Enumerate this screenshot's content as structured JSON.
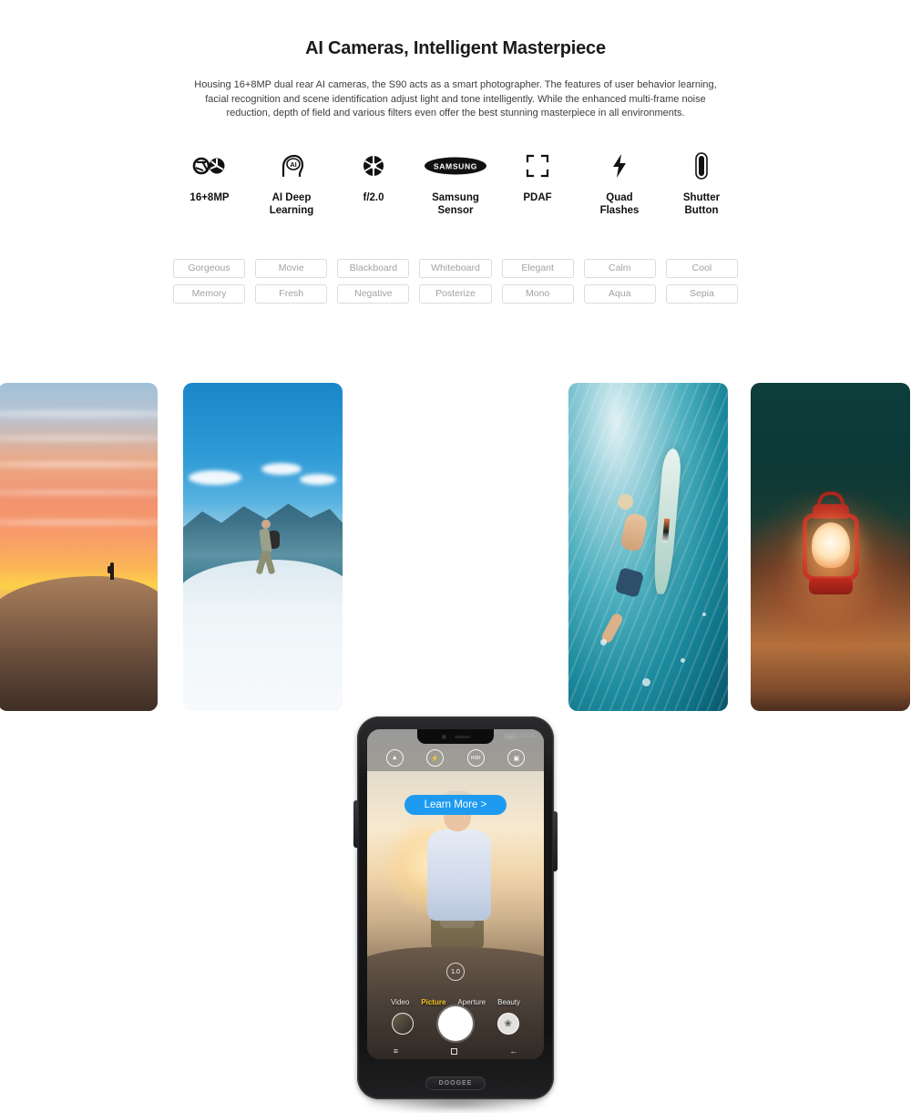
{
  "hero": {
    "title": "AI Cameras, Intelligent Masterpiece",
    "description": "Housing 16+8MP dual rear AI cameras, the S90 acts as a smart photographer. The features of user behavior learning, facial recognition and scene identification adjust light and tone intelligently. While the enhanced multi-frame noise reduction, depth of field and various filters even offer the best stunning masterpiece in all environments."
  },
  "specs": [
    {
      "icon": "dual-aperture-icon",
      "label": "16+8MP"
    },
    {
      "icon": "ai-head-icon",
      "label": "AI Deep\nLearning"
    },
    {
      "icon": "aperture-icon",
      "label": "f/2.0"
    },
    {
      "icon": "samsung-logo-icon",
      "label": "Samsung\nSensor"
    },
    {
      "icon": "focus-bracket-icon",
      "label": "PDAF"
    },
    {
      "icon": "lightning-bolt-icon",
      "label": "Quad\nFlashes"
    },
    {
      "icon": "shutter-button-icon",
      "label": "Shutter\nButton"
    }
  ],
  "filters": [
    "Gorgeous",
    "Movie",
    "Blackboard",
    "Whiteboard",
    "Elegant",
    "Calm",
    "Cool",
    "Memory",
    "Fresh",
    "Negative",
    "Posterize",
    "Mono",
    "Aqua",
    "Sepia"
  ],
  "gallery": [
    {
      "name": "desert-sunset-photo",
      "caption": "Desert sunset with lone traveler"
    },
    {
      "name": "mountain-hiker-photo",
      "caption": "Hiker on snowy mountain ridge"
    },
    {
      "name": "underwater-surfer-photo",
      "caption": "Surfer diving underwater with board"
    },
    {
      "name": "red-lantern-photo",
      "caption": "Red lantern glowing on night sand"
    }
  ],
  "phone": {
    "brand": "DOOGEE",
    "status": {
      "time": "12:00"
    },
    "controls": [
      {
        "name": "scene-mode-icon",
        "glyph": "▲"
      },
      {
        "name": "flash-icon",
        "glyph": "⚡"
      },
      {
        "name": "hdr-icon",
        "glyph": "HDR"
      },
      {
        "name": "switch-camera-icon",
        "glyph": "▣"
      }
    ],
    "zoom_level": "1.0",
    "modes": [
      {
        "label": "Video",
        "active": false
      },
      {
        "label": "Picture",
        "active": true
      },
      {
        "label": "Aperture",
        "active": false
      },
      {
        "label": "Beauty",
        "active": false
      }
    ],
    "actions": {
      "gallery_label": "gallery-thumbnail",
      "shutter_label": "shutter",
      "filter_label": "❀"
    },
    "navbar": {
      "recents": "≡",
      "home": "",
      "back": "←"
    }
  },
  "cta": {
    "label": "Learn More >",
    "color": "#1e9bf0"
  }
}
